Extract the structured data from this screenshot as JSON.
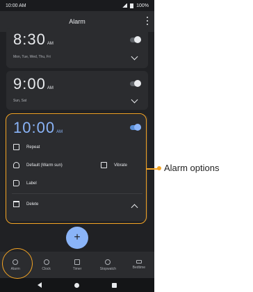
{
  "status_bar": {
    "time": "10:00 AM",
    "battery": "100%"
  },
  "app_bar": {
    "title": "Alarm"
  },
  "alarms": [
    {
      "time": "8:30",
      "ampm": "AM",
      "days": "Mon, Tue, Wed, Thu, Fri",
      "enabled": false
    },
    {
      "time": "9:00",
      "ampm": "AM",
      "days": "Sun, Sat",
      "enabled": false
    },
    {
      "time": "10:00",
      "ampm": "AM",
      "enabled": true,
      "options": {
        "repeat": "Repeat",
        "sound": "Default (Warm sun)",
        "vibrate": "Vibrate",
        "label": "Label",
        "delete": "Delete"
      }
    }
  ],
  "fab": {
    "label": "+"
  },
  "bottom_nav": [
    {
      "label": "Alarm",
      "icon": "alarm-icon"
    },
    {
      "label": "Clock",
      "icon": "clock-icon"
    },
    {
      "label": "Timer",
      "icon": "hourglass-icon"
    },
    {
      "label": "Stopwatch",
      "icon": "stopwatch-icon"
    },
    {
      "label": "Bedtime",
      "icon": "bed-icon"
    }
  ],
  "annotation": {
    "callout": "Alarm options",
    "color": "#f5a524"
  }
}
